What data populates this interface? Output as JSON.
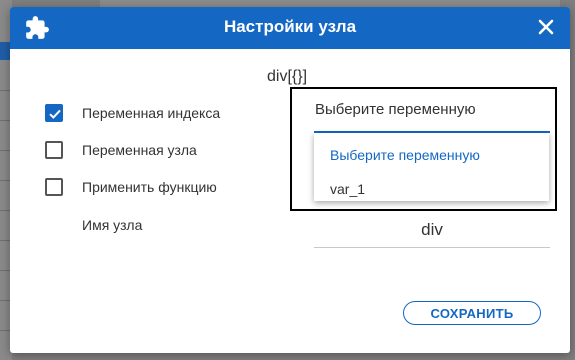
{
  "colors": {
    "accent": "#1468c4",
    "text": "#333333",
    "overlay": "#7f7f7f"
  },
  "dialog": {
    "title": "Настройки узла",
    "title_icon": "puzzle-icon",
    "close_icon": "close-icon",
    "node_label": "div[{}]",
    "options": [
      {
        "label": "Переменная индекса",
        "checked": true
      },
      {
        "label": "Переменная узла",
        "checked": false
      },
      {
        "label": "Применить функцию",
        "checked": false
      }
    ],
    "name_label": "Имя узла",
    "variable_select": {
      "value": "Выберите переменную",
      "options": [
        "Выберите переменную",
        "var_1"
      ]
    },
    "node_name_value": "div",
    "save_label": "СОХРАНИТЬ"
  }
}
